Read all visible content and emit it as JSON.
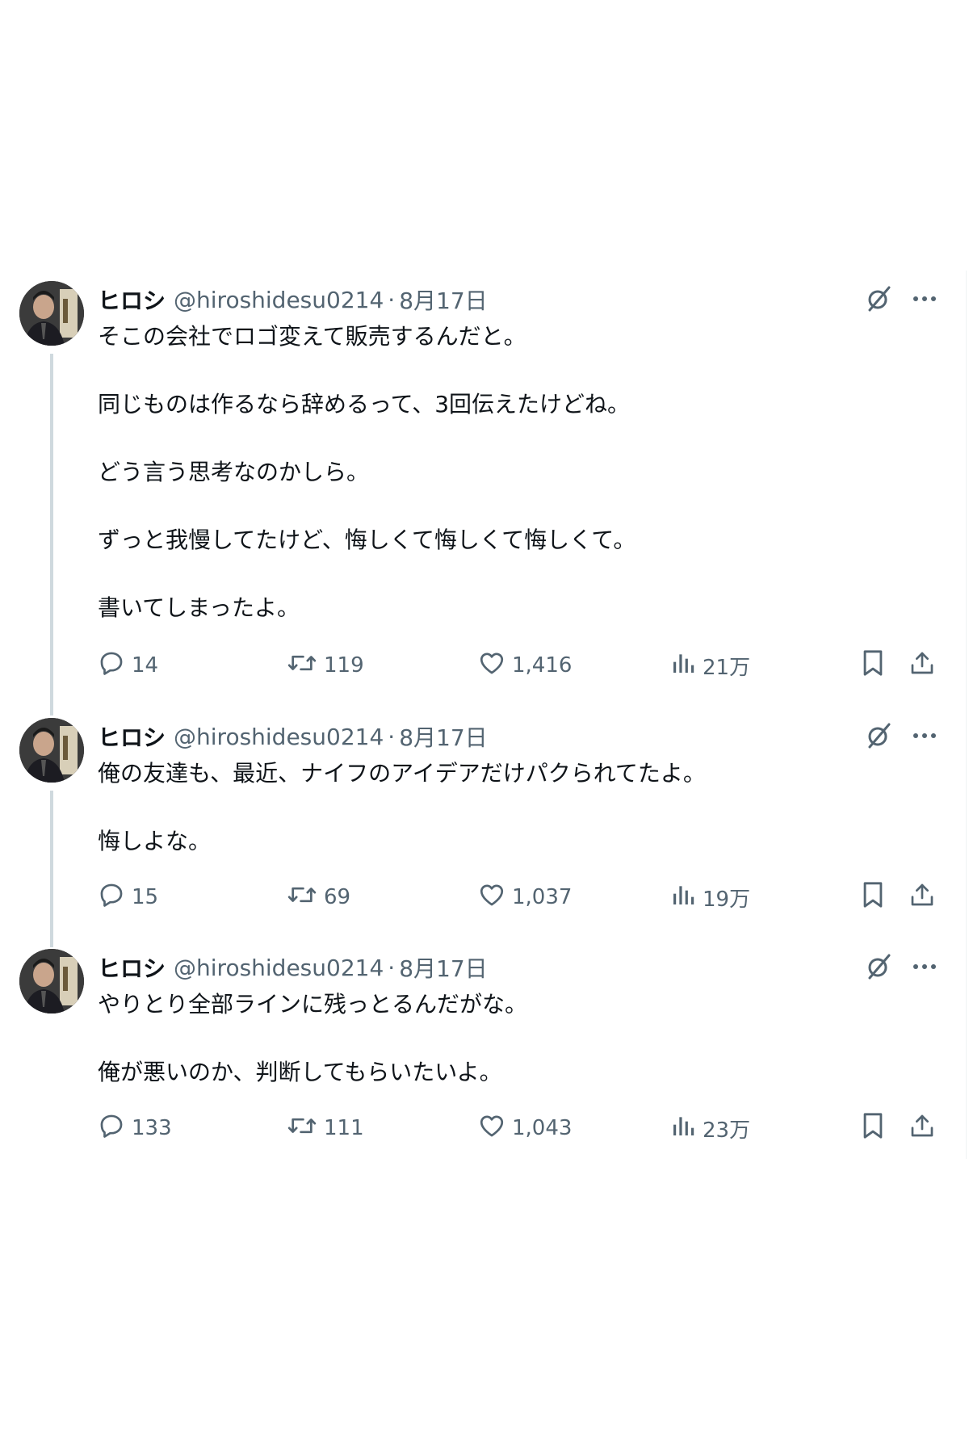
{
  "tweets": [
    {
      "name": "ヒロシ",
      "handle": "@hiroshidesu0214",
      "separator": "·",
      "date": "8月17日",
      "paragraphs": [
        "そこの会社でロゴ変えて販売するんだと。",
        "同じものは作るなら辞めるって、3回伝えたけどね。",
        "どう言う思考なのかしら。",
        "ずっと我慢してたけど、悔しくて悔しくて悔しくて。",
        "書いてしまったよ。"
      ],
      "replies": "14",
      "retweets": "119",
      "likes": "1,416",
      "views": "21万"
    },
    {
      "name": "ヒロシ",
      "handle": "@hiroshidesu0214",
      "separator": "·",
      "date": "8月17日",
      "paragraphs": [
        "俺の友達も、最近、ナイフのアイデアだけパクられてたよ。",
        "悔しよな。"
      ],
      "replies": "15",
      "retweets": "69",
      "likes": "1,037",
      "views": "19万"
    },
    {
      "name": "ヒロシ",
      "handle": "@hiroshidesu0214",
      "separator": "·",
      "date": "8月17日",
      "paragraphs": [
        "やりとり全部ラインに残っとるんだがな。",
        "俺が悪いのか、判断してもらいたいよ。"
      ],
      "replies": "133",
      "retweets": "111",
      "likes": "1,043",
      "views": "23万"
    }
  ],
  "icons": {
    "top_right": [
      "grok-icon",
      "more-icon"
    ],
    "actions": [
      "reply-icon",
      "retweet-icon",
      "like-icon",
      "views-icon",
      "bookmark-icon",
      "share-icon"
    ]
  },
  "colors": {
    "text": "#0f1419",
    "secondary": "#536471",
    "thread_line": "#cfd9de"
  }
}
